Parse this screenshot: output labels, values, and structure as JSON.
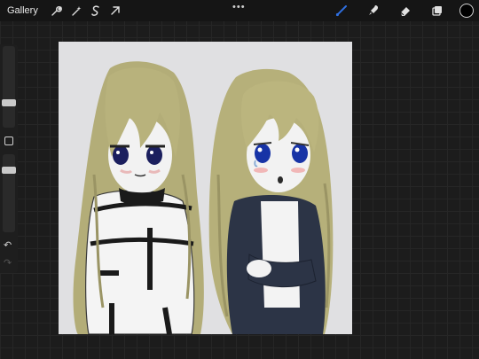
{
  "toolbar": {
    "gallery_label": "Gallery",
    "left_icons": [
      "wrench-icon",
      "magic-wand-icon",
      "selection-s-icon",
      "transform-arrow-icon"
    ],
    "more_label": "•••",
    "right_icons": [
      "brush-icon",
      "smudge-icon",
      "eraser-icon",
      "layers-icon"
    ],
    "active_tool": "brush-icon",
    "active_color": "#000000",
    "accent_color": "#2f6fe0"
  },
  "sidebar": {
    "undo_label": "↶",
    "redo_label": "↷"
  },
  "canvas": {
    "background": "#e0e0e2"
  }
}
